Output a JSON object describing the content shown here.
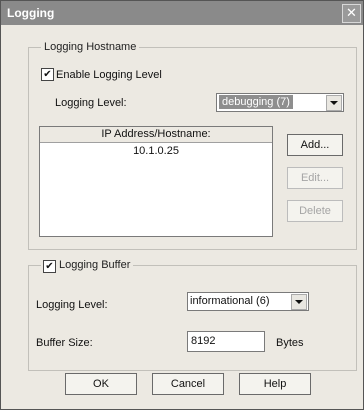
{
  "window": {
    "title": "Logging",
    "close_glyph": "✕"
  },
  "logging_hostname": {
    "legend": "Logging Hostname",
    "enable_checkbox_label": "Enable Logging Level",
    "enable_checked": true,
    "level_label": "Logging Level:",
    "level_value": "debugging (7)",
    "table": {
      "columns": [
        "IP Address/Hostname:"
      ],
      "rows": [
        "10.1.0.25"
      ]
    },
    "buttons": {
      "add": "Add...",
      "edit": "Edit...",
      "delete": "Delete"
    }
  },
  "logging_buffer": {
    "legend": "Logging Buffer",
    "checked": true,
    "level_label": "Logging Level:",
    "level_value": "informational (6)",
    "size_label": "Buffer Size:",
    "size_value": "8192",
    "size_unit": "Bytes"
  },
  "footer": {
    "ok": "OK",
    "cancel": "Cancel",
    "help": "Help"
  },
  "glyphs": {
    "check": "✔"
  }
}
